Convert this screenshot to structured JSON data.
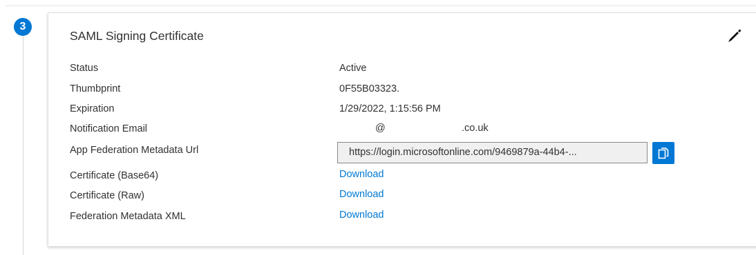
{
  "step": {
    "number": "3"
  },
  "card": {
    "title": "SAML Signing Certificate",
    "edit_icon": "pencil-icon"
  },
  "fields": {
    "status": {
      "label": "Status",
      "value": "Active"
    },
    "thumbprint": {
      "label": "Thumbprint",
      "value": "0F55B03323."
    },
    "expiration": {
      "label": "Expiration",
      "value": "1/29/2022, 1:15:56 PM"
    },
    "notification_email": {
      "label": "Notification Email",
      "at": "@",
      "domain": ".co.uk"
    },
    "metadata_url": {
      "label": "App Federation Metadata Url",
      "value": "https://login.microsoftonline.com/9469879a-44b4-...",
      "copy_icon": "copy-icon"
    },
    "cert_base64": {
      "label": "Certificate (Base64)",
      "link": "Download"
    },
    "cert_raw": {
      "label": "Certificate (Raw)",
      "link": "Download"
    },
    "federation_xml": {
      "label": "Federation Metadata XML",
      "link": "Download"
    }
  },
  "colors": {
    "accent": "#0078d4",
    "text": "#323130",
    "url_box_bg": "#f0f0f0"
  }
}
